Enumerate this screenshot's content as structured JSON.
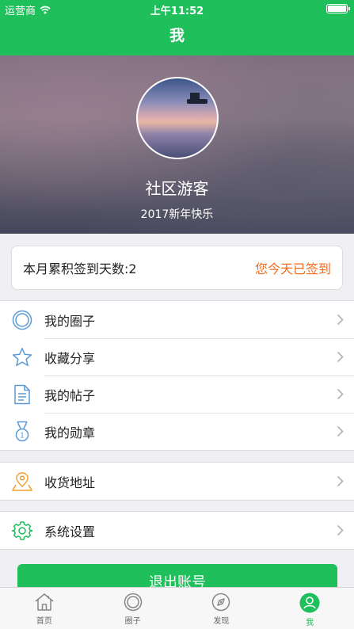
{
  "status_bar": {
    "carrier": "运营商",
    "time": "上午11:52"
  },
  "nav": {
    "title": "我"
  },
  "profile": {
    "username": "社区游客",
    "motto": "2017新年快乐"
  },
  "signin": {
    "count_text": "本月累积签到天数:2",
    "status_text": "您今天已签到"
  },
  "menu_main": [
    {
      "label": "我的圈子",
      "icon": "circle-icon"
    },
    {
      "label": "收藏分享",
      "icon": "star-icon"
    },
    {
      "label": "我的帖子",
      "icon": "document-icon"
    },
    {
      "label": "我的勋章",
      "icon": "medal-icon"
    }
  ],
  "menu_address": [
    {
      "label": "收货地址",
      "icon": "location-pin-icon"
    }
  ],
  "menu_settings": [
    {
      "label": "系统设置",
      "icon": "gear-icon"
    }
  ],
  "logout": {
    "label": "退出账号"
  },
  "tabbar": [
    {
      "label": "首页",
      "icon": "home-icon",
      "active": false
    },
    {
      "label": "圈子",
      "icon": "circle-icon",
      "active": false
    },
    {
      "label": "发现",
      "icon": "compass-icon",
      "active": false
    },
    {
      "label": "我",
      "icon": "user-icon",
      "active": true
    }
  ],
  "colors": {
    "brand_green": "#1fbf5c",
    "signed_orange": "#f26b1d",
    "icon_blue": "#5b9bd5"
  }
}
